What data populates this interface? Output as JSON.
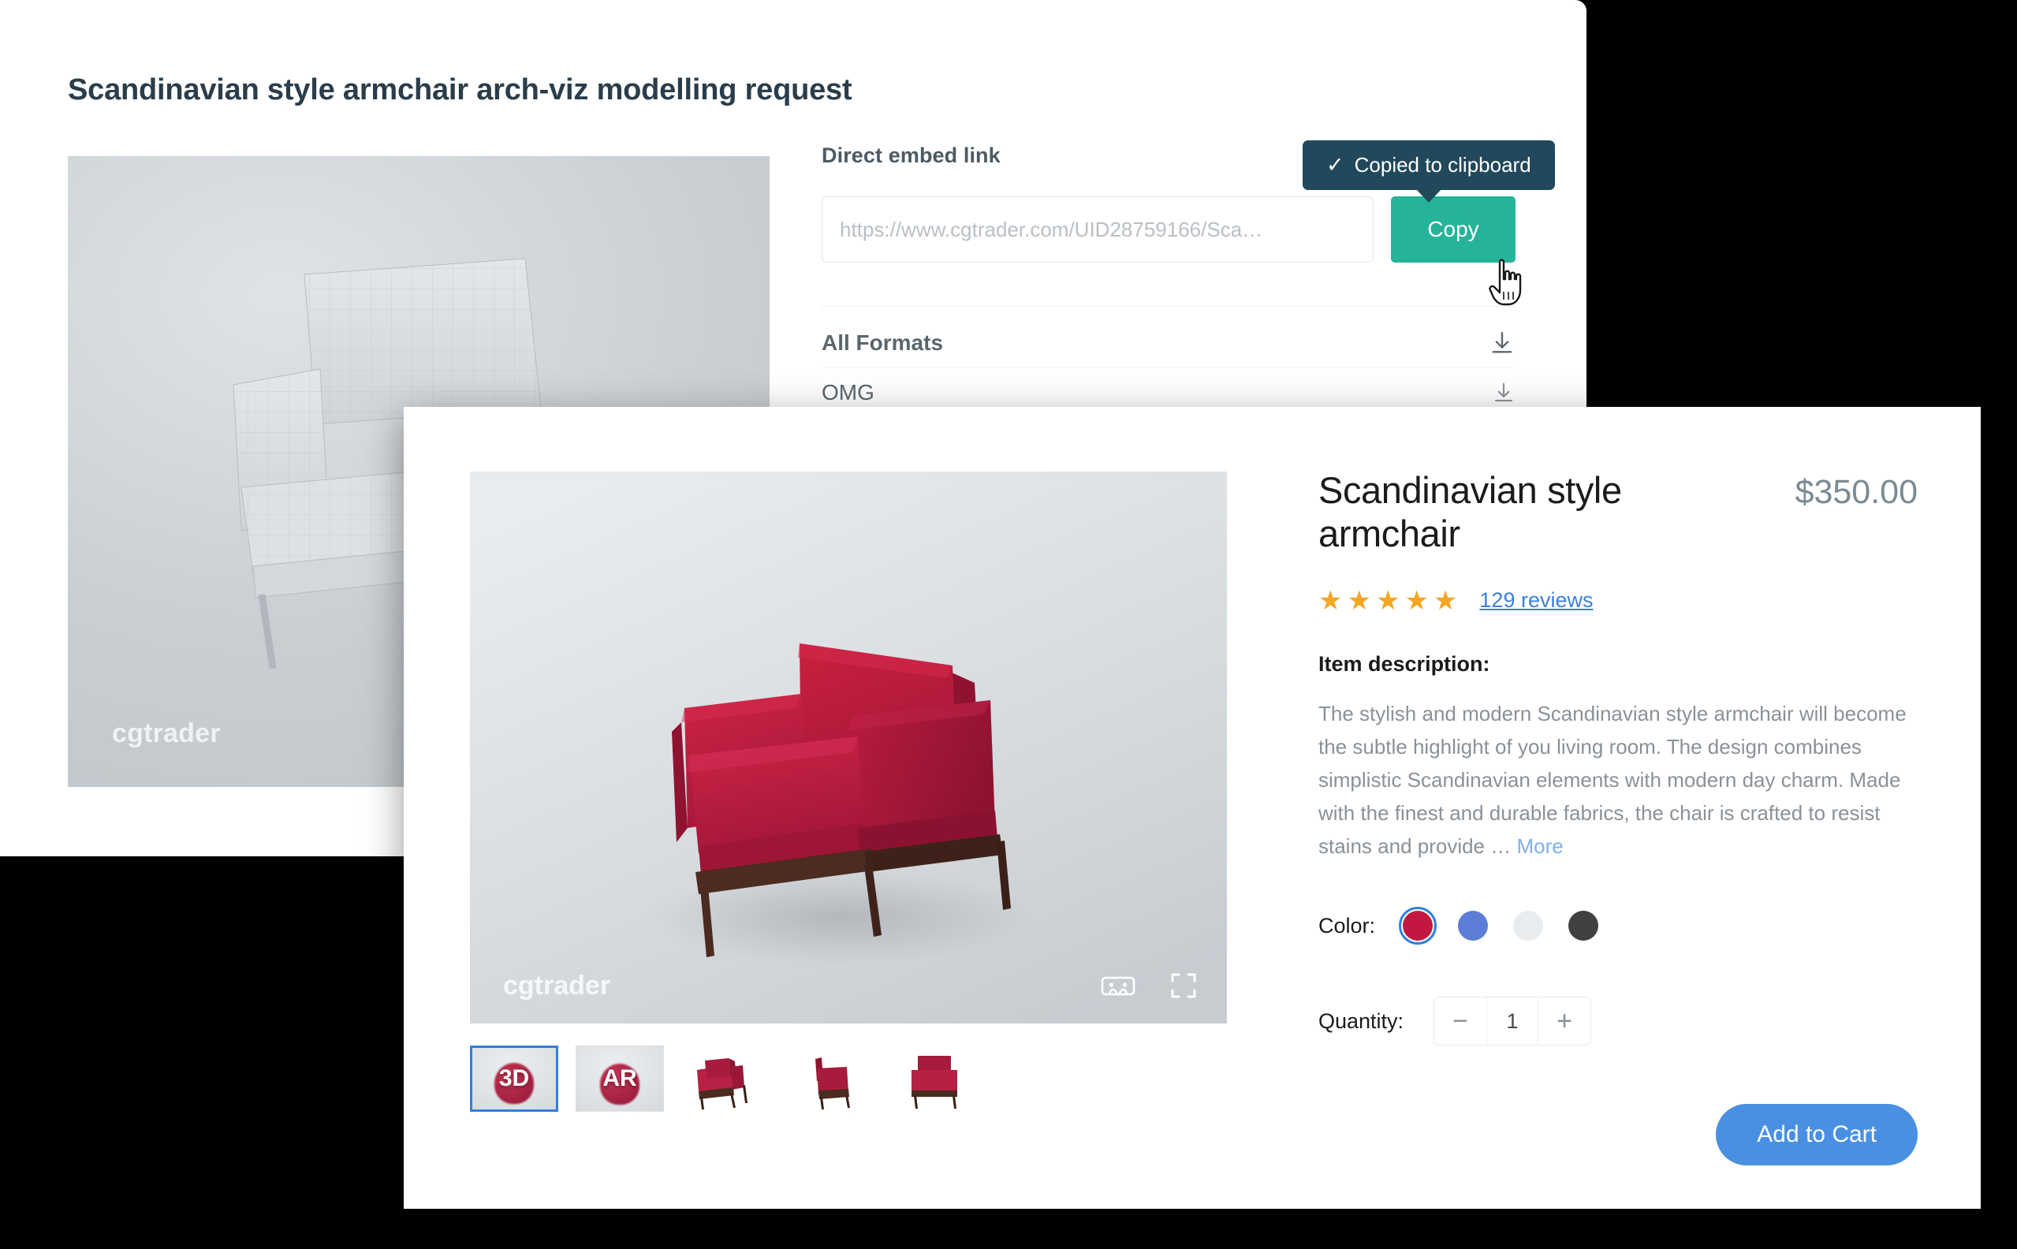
{
  "back_card": {
    "title": "Scandinavian style armchair arch-viz modelling request",
    "watermark": "cgtrader",
    "embed": {
      "label": "Direct embed link",
      "placeholder": "https://www.cgtrader.com/UID28759166/Sca…",
      "value": "",
      "copy_label": "Copy"
    },
    "tooltip": {
      "check": "✓",
      "text": "Copied to clipboard"
    },
    "formats": [
      {
        "label": "All Formats",
        "icon": "download-icon"
      },
      {
        "label": "OMG",
        "icon": "download-icon"
      }
    ]
  },
  "front_card": {
    "viewer": {
      "watermark": "cgtrader",
      "controls": [
        {
          "name": "vr-goggles-icon"
        },
        {
          "name": "fullscreen-icon"
        }
      ]
    },
    "thumbnails": [
      {
        "label": "3D",
        "type": "badge",
        "selected": true
      },
      {
        "label": "AR",
        "type": "badge",
        "selected": false
      },
      {
        "label": "",
        "type": "chair-front",
        "selected": false
      },
      {
        "label": "",
        "type": "chair-side",
        "selected": false
      },
      {
        "label": "",
        "type": "chair-back",
        "selected": false
      }
    ],
    "product": {
      "title": "Scandinavian style armchair",
      "price": "$350.00",
      "stars": "★★★★★",
      "star_color": "#f5a623",
      "rating_count": 5,
      "reviews_label": "129 reviews",
      "description_heading": "Item description:",
      "description": "The stylish and modern Scandinavian style armchair will become the subtle highlight of you living room. The design combines simplistic Scandinavian elements with modern day charm. Made with  the finest and durable fabrics, the chair is crafted to resist stains and provide …",
      "more_label": "More",
      "color_label": "Color:",
      "colors": [
        {
          "name": "crimson",
          "hex": "#c2183f",
          "selected": true
        },
        {
          "name": "blue",
          "hex": "#5c7ed6",
          "selected": false
        },
        {
          "name": "white",
          "hex": "#e8ecef",
          "selected": false
        },
        {
          "name": "dark-gray",
          "hex": "#414141",
          "selected": false
        }
      ],
      "quantity_label": "Quantity:",
      "quantity_value": "1",
      "decrement_label": "−",
      "increment_label": "+",
      "add_to_cart_label": "Add to Cart",
      "add_to_cart_color": "#4a90e2"
    }
  },
  "theme": {
    "background": "#000000",
    "copy_button": "#25b39a",
    "tooltip_bg": "#22485c",
    "link_blue": "#3d7fd6",
    "title_navy": "#2b3d4a"
  }
}
